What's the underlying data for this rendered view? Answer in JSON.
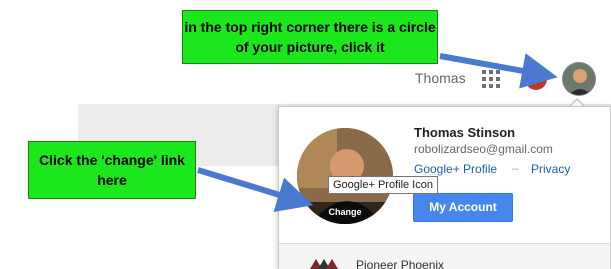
{
  "topbar": {
    "user_first_name": "Thomas",
    "apps_icon": "apps-grid-icon",
    "notification_icon": "notification-icon",
    "avatar_icon": "profile-avatar"
  },
  "callouts": {
    "top": "in the top right corner there is a circle of your picture, click it",
    "left": "Click the 'change' link here",
    "color": "#1ce61c"
  },
  "popup": {
    "name": "Thomas Stinson",
    "email": "robolizardseo@gmail.com",
    "gplus_profile_link": "Google+ Profile",
    "separator": "–",
    "privacy_link": "Privacy",
    "change_label": "Change",
    "my_account_button": "My Account",
    "tooltip": "Google+ Profile Icon",
    "button_color": "#4787ed",
    "link_color": "#1a5fb4"
  },
  "other_accounts": {
    "item_name": "Pioneer Phoenix"
  }
}
